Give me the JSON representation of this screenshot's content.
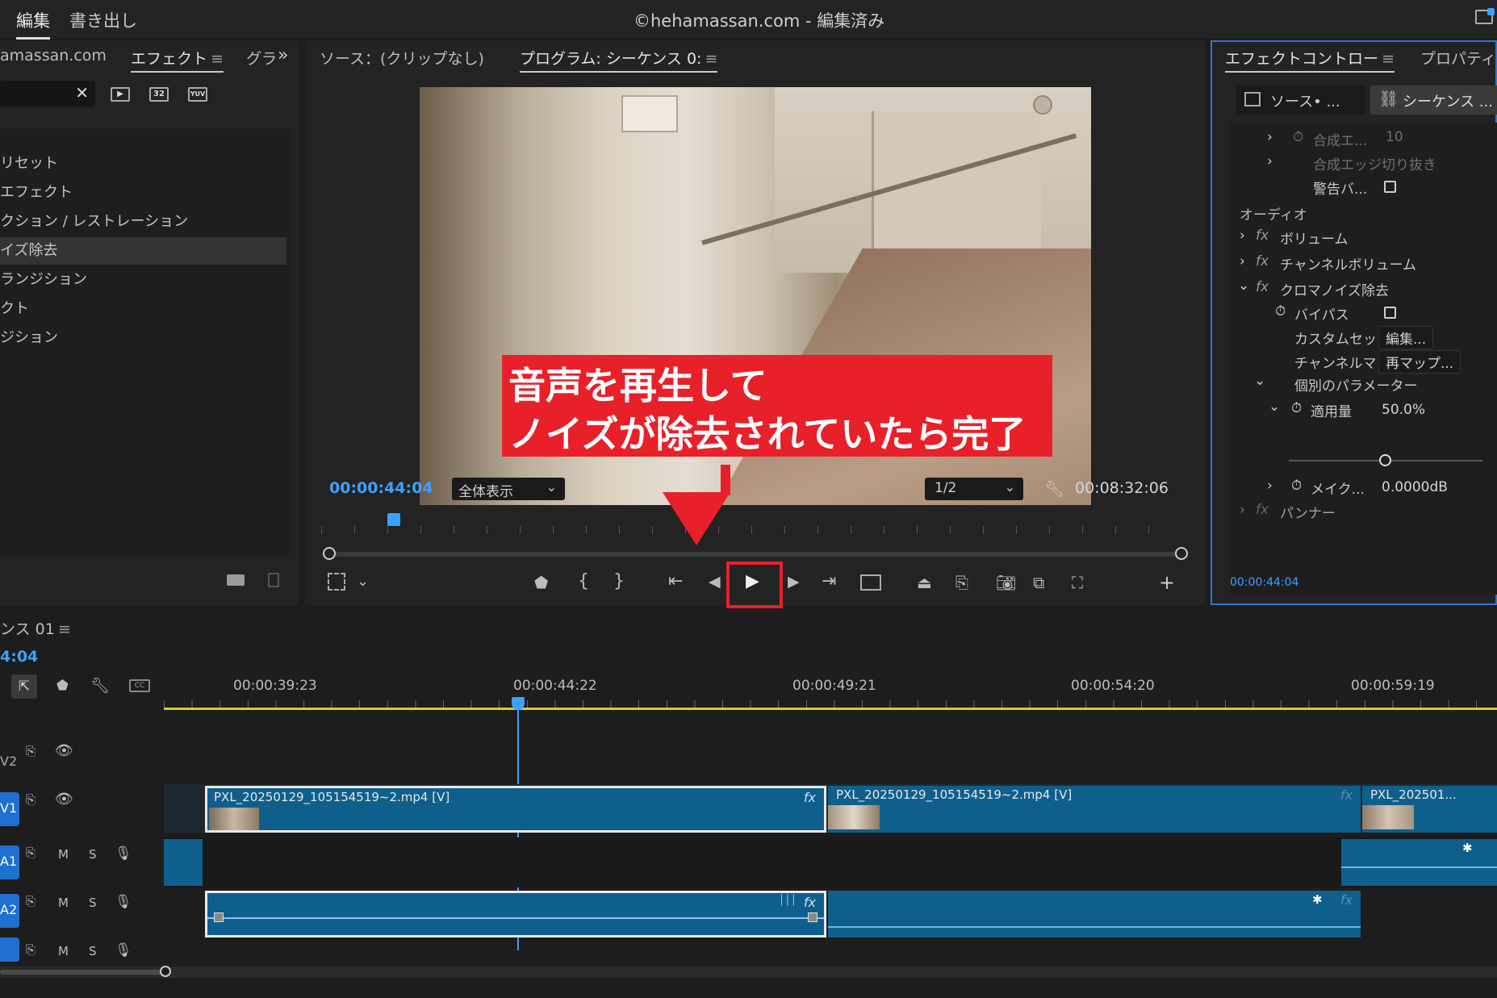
{
  "topbar": {
    "tab_edit": "編集",
    "tab_export": "書き出し",
    "window_title": "©hehamassan.com - 編集済み"
  },
  "project_panel": {
    "tab_project": "amassan.com",
    "tab_effects": "エフェクト",
    "tab_graphics": "グラ",
    "tree": [
      "リセット",
      "エフェクト",
      "クション / レストレーション",
      "イズ除去",
      "ランジション",
      "クト",
      "ジション"
    ]
  },
  "monitor": {
    "tab_source": "ソース：(クリップなし)",
    "tab_program": "プログラム: シーケンス 0:",
    "current_time": "00:00:44:04",
    "fit": "全体表示",
    "quality": "1/2",
    "duration": "00:08:32:06"
  },
  "annotation": {
    "line1": "音声を再生して",
    "line2": "ノイズが除去されていたら完了"
  },
  "effect_controls": {
    "tab_ec": "エフェクトコントロー",
    "tab_props": "プロパティ",
    "source_btn": "ソース• ...",
    "seq_btn": "シーケンス ...",
    "row_composite": "合成エ...",
    "row_composite_val": "10",
    "row_edge": "合成エッジ切り抜き",
    "row_warning": "警告バ...",
    "audio_header": "オーディオ",
    "row_volume": "ボリューム",
    "row_channel_volume": "チャンネルボリューム",
    "row_chroma": "クロマノイズ除去",
    "row_bypass": "バイパス",
    "row_custom": "カスタムセット",
    "btn_edit": "編集...",
    "row_channel_map": "チャンネルマッ",
    "btn_remap": "再マップ...",
    "row_individual": "個別のパラメーター",
    "row_amount": "適用量",
    "amount_val": "50.0%",
    "row_makeup": "メイク...",
    "makeup_val": "0.0000dB",
    "row_panner": "パンナー",
    "timecode": "00:00:44:04",
    "slider_level": 0.5
  },
  "timeline": {
    "tab": "ンス 01",
    "timecode": "4:04",
    "ruler": [
      "00:00:39:23",
      "00:00:44:22",
      "00:00:49:21",
      "00:00:54:20",
      "00:00:59:19"
    ],
    "tracks": {
      "v2": "V2",
      "v1": "V1",
      "a1": "A1",
      "a2": "A2",
      "m": "M",
      "s": "S"
    },
    "clips": {
      "v1_clip1": "PXL_20250129_105154519~2.mp4 [V]",
      "v1_clip2": "PXL_20250129_105154519~2.mp4 [V]",
      "v1_clip3": "PXL_202501..."
    },
    "fx_label": "fx"
  },
  "colors": {
    "accent_blue": "#3ea0ff",
    "clip_blue": "#0f5f8c",
    "annotation_red": "#e8202a"
  }
}
